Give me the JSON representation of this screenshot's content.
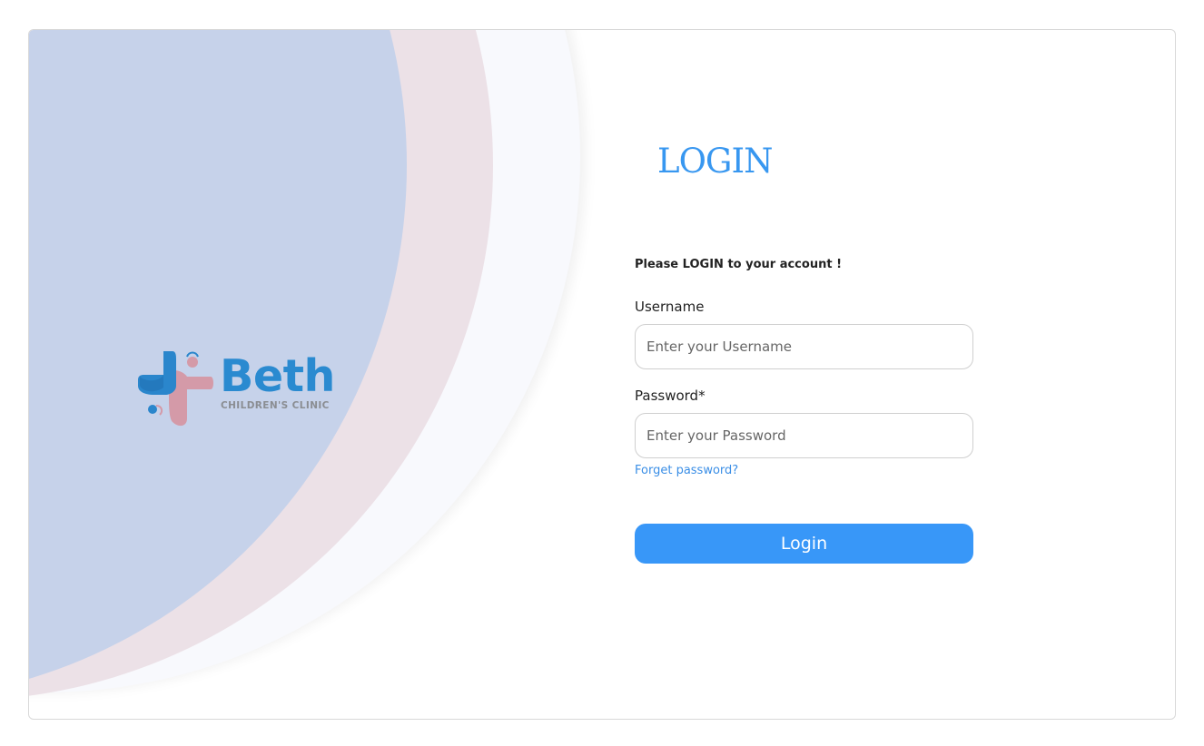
{
  "brand": {
    "name": "Beth",
    "tagline": "CHILDREN'S CLINIC"
  },
  "login": {
    "title": "LOGIN",
    "subtitle": "Please LOGIN to your account !",
    "username_label": "Username",
    "username_placeholder": "Enter your Username",
    "username_value": "",
    "password_label": "Password*",
    "password_placeholder": "Enter your Password",
    "password_value": "",
    "forget_password": "Forget password?",
    "submit_label": "Login"
  },
  "colors": {
    "accent": "#3897f8",
    "brand_blue": "#2a8ad0",
    "brand_pink": "#d49aa8",
    "circle_blue": "#c6d2ea",
    "circle_pink": "#ece1e7"
  },
  "icons": [
    "clinic-cross-logo-icon"
  ]
}
